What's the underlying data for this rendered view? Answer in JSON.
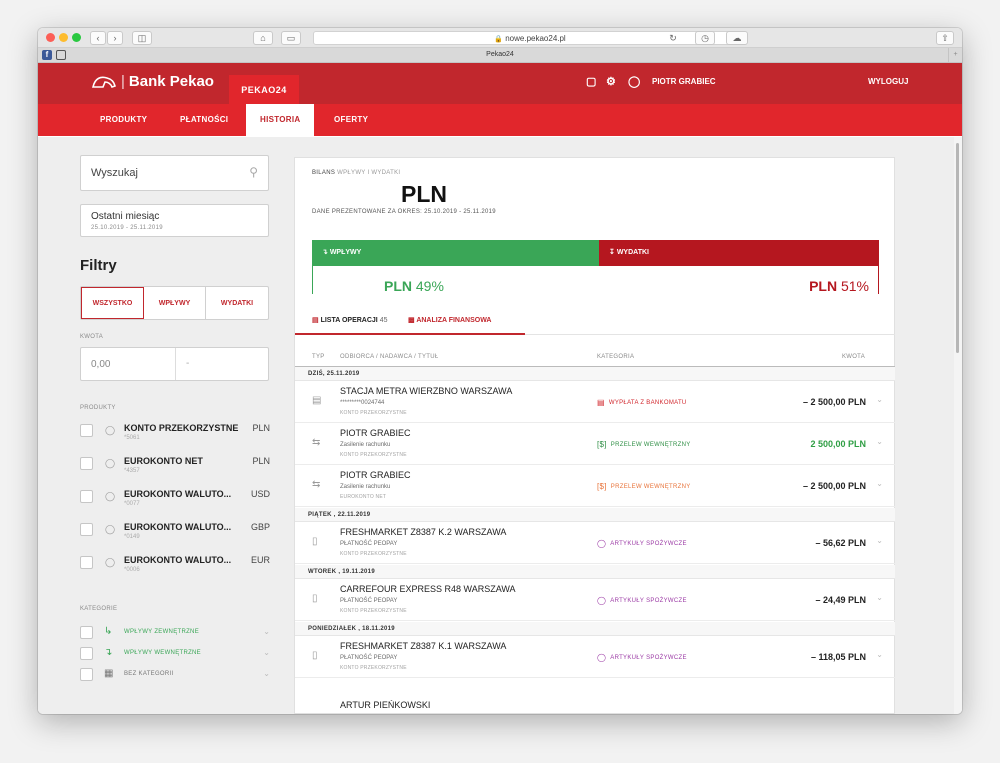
{
  "browser": {
    "url": "nowe.pekao24.pl",
    "tab_title": "Pekao24"
  },
  "header": {
    "logo": "Bank Pekao",
    "pekao24": "PEKAO24",
    "user": "PIOTR GRABIEC",
    "logout": "WYLOGUJ"
  },
  "nav": [
    "PRODUKTY",
    "PŁATNOŚCI",
    "HISTORIA",
    "OFERTY"
  ],
  "sidebar": {
    "search_placeholder": "Wyszukaj",
    "period_label": "Ostatni miesiąc",
    "period_range": "25.10.2019 - 25.11.2019",
    "filters_title": "Filtry",
    "filter_buttons": [
      "WSZYSTKO",
      "WPŁYWY",
      "WYDATKI"
    ],
    "amount_label": "KWOTA",
    "amount_from": "0,00",
    "amount_sep": "-",
    "products_label": "PRODUKTY",
    "products": [
      {
        "name": "KONTO PRZEKORZYSTNE",
        "cur": "PLN",
        "num": "*5061"
      },
      {
        "name": "EUROKONTO NET",
        "cur": "PLN",
        "num": "*4357"
      },
      {
        "name": "EUROKONTO WALUTO...",
        "cur": "USD",
        "num": "*0077"
      },
      {
        "name": "EUROKONTO WALUTO...",
        "cur": "GBP",
        "num": "*0149"
      },
      {
        "name": "EUROKONTO WALUTO...",
        "cur": "EUR",
        "num": "*0006"
      }
    ],
    "categories_label": "KATEGORIE",
    "categories": [
      {
        "name": "WPŁYWY ZEWNĘTRZNE",
        "color": "#3aa657"
      },
      {
        "name": "WPŁYWY WEWNĘTRZNE",
        "color": "#3aa657"
      },
      {
        "name": "BEZ KATEGORII",
        "color": "#777777"
      }
    ]
  },
  "main": {
    "bilans": "BILANS",
    "bilans_sub": "WPŁYWY I WYDATKI",
    "currency": "PLN",
    "period_text": "DANE PREZENTOWANE ZA OKRES: 25.10.2019 - 25.11.2019",
    "in_label": "WPŁYWY",
    "out_label": "WYDATKI",
    "in_cur": "PLN",
    "in_pct": "49%",
    "out_cur": "PLN",
    "out_pct": "51%",
    "tab_list": "LISTA OPERACJI",
    "tab_count": "45",
    "tab_analysis": "ANALIZA FINANSOWA",
    "col_type": "TYP",
    "col_party": "ODBIORCA / NADAWCA / TYTUŁ",
    "col_cat": "KATEGORIA",
    "col_amt": "KWOTA",
    "groups": [
      {
        "date": "DZIŚ, 25.11.2019",
        "rows": [
          {
            "title": "STACJA METRA WIERZBNO WARSZAWA",
            "sub": "*********0024744",
            "acct": "KONTO PRZEKORZYSTNE",
            "cat": "WYPŁATA Z BANKOMATU",
            "cat_color": "#d1262c",
            "amount": "– 2 500,00 PLN",
            "amt_color": "#222222",
            "icon": "atm-icon"
          },
          {
            "title": "PIOTR GRABIEC",
            "sub": "Zasilenie rachunku",
            "acct": "KONTO PRZEKORZYSTNE",
            "cat": "PRZELEW WEWNĘTRZNY",
            "cat_color": "#2f8f45",
            "amount": "2 500,00 PLN",
            "amt_color": "#2f9e44",
            "icon": "transfer-icon"
          },
          {
            "title": "PIOTR GRABIEC",
            "sub": "Zasilenie rachunku",
            "acct": "EUROKONTO NET",
            "cat": "PRZELEW WEWNĘTRZNY",
            "cat_color": "#e8733a",
            "amount": "– 2 500,00 PLN",
            "amt_color": "#222222",
            "icon": "transfer-icon"
          }
        ]
      },
      {
        "date": "PIĄTEK , 22.11.2019",
        "rows": [
          {
            "title": "FRESHMARKET Z8387 K.2 WARSZAWA",
            "sub": "PŁATNOŚĆ PEOPAY",
            "acct": "KONTO PRZEKORZYSTNE",
            "cat": "ARTYKUŁY SPOŻYWCZE",
            "cat_color": "#9b3aa5",
            "amount": "– 56,62 PLN",
            "amt_color": "#222222",
            "icon": "phone-icon"
          }
        ]
      },
      {
        "date": "WTOREK , 19.11.2019",
        "rows": [
          {
            "title": "CARREFOUR EXPRESS R48 WARSZAWA",
            "sub": "PŁATNOŚĆ PEOPAY",
            "acct": "KONTO PRZEKORZYSTNE",
            "cat": "ARTYKUŁY SPOŻYWCZE",
            "cat_color": "#9b3aa5",
            "amount": "– 24,49 PLN",
            "amt_color": "#222222",
            "icon": "phone-icon"
          }
        ]
      },
      {
        "date": "PONIEDZIAŁEK , 18.11.2019",
        "rows": [
          {
            "title": "FRESHMARKET Z8387 K.1 WARSZAWA",
            "sub": "PŁATNOŚĆ PEOPAY",
            "acct": "KONTO PRZEKORZYSTNE",
            "cat": "ARTYKUŁY SPOŻYWCZE",
            "cat_color": "#9b3aa5",
            "amount": "– 118,05 PLN",
            "amt_color": "#222222",
            "icon": "phone-icon"
          }
        ]
      }
    ],
    "last_partial": "ARTUR PIEŃKOWSKI"
  }
}
